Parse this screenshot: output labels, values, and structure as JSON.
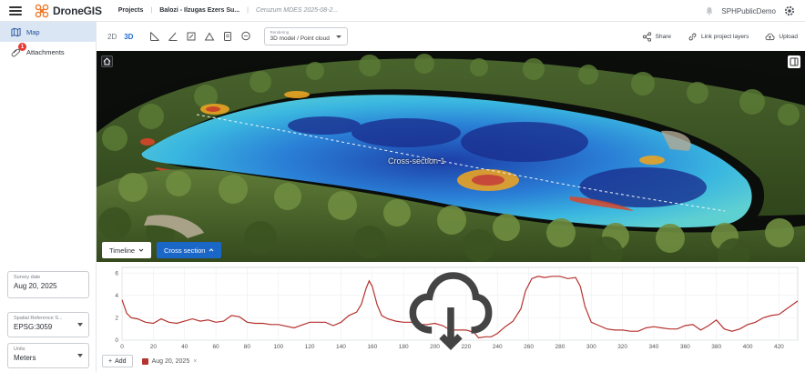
{
  "app": {
    "name": "DroneGIS",
    "user": "SPHPublicDemo"
  },
  "breadcrumbs": [
    "Projects",
    "Balozi - Ilzugas Ezers Su...",
    "Ceruzum MDES 2025-08-2..."
  ],
  "nav": {
    "map_label": "Map",
    "attachments_label": "Attachments",
    "attachments_count": "1"
  },
  "fields": {
    "survey_date": {
      "label": "Survey date",
      "value": "Aug 20, 2025"
    },
    "crs": {
      "label": "Spatial Reference S...",
      "value": "EPSG:3059"
    },
    "units": {
      "label": "Units",
      "value": "Meters"
    }
  },
  "toolbar": {
    "mode_2d": "2D",
    "mode_3d": "3D",
    "view_select": {
      "label": "Rendering",
      "value": "3D model / Point cloud"
    },
    "share_label": "Share",
    "link_label": "Link project layers",
    "upload_label": "Upload"
  },
  "viewport": {
    "cross_section_label": "Cross-section 1",
    "timeline_label": "Timeline",
    "cross_section_button": "Cross section"
  },
  "profile": {
    "add_label": "Add",
    "legend_label": "Aug 20, 2025",
    "colors": {
      "line": "#b5322e",
      "accent": "#1a67c8"
    }
  },
  "chart_data": {
    "type": "line",
    "x_ticks": [
      0,
      20,
      40,
      60,
      80,
      100,
      120,
      140,
      160,
      180,
      200,
      220,
      240,
      260,
      280,
      300,
      320,
      340,
      360,
      380,
      400,
      420
    ],
    "y_ticks": [
      0,
      2,
      4,
      6
    ],
    "xlim": [
      0,
      432
    ],
    "ylim": [
      0,
      6.5
    ],
    "grid": true,
    "series": [
      {
        "x": [
          0,
          3,
          6,
          10,
          15,
          20,
          25,
          30,
          35,
          40,
          45,
          50,
          55,
          60,
          65,
          70,
          75,
          80,
          85,
          90,
          95,
          100,
          110,
          120,
          130,
          135,
          140,
          145,
          150,
          153,
          156,
          158,
          160,
          163,
          166,
          170,
          175,
          180,
          185,
          190,
          195,
          200,
          205,
          210,
          215,
          220,
          225,
          228,
          232,
          236,
          240,
          245,
          250,
          255,
          258,
          262,
          266,
          270,
          275,
          280,
          285,
          290,
          293,
          296,
          300,
          305,
          310,
          315,
          320,
          325,
          330,
          335,
          340,
          345,
          350,
          355,
          360,
          365,
          370,
          375,
          380,
          385,
          390,
          395,
          400,
          405,
          410,
          415,
          420,
          425,
          430,
          432
        ],
        "y": [
          3.6,
          2.4,
          2.0,
          1.9,
          1.6,
          1.5,
          1.9,
          1.6,
          1.5,
          1.7,
          1.9,
          1.7,
          1.8,
          1.6,
          1.7,
          2.2,
          2.1,
          1.6,
          1.5,
          1.5,
          1.4,
          1.4,
          1.1,
          1.6,
          1.6,
          1.3,
          1.6,
          2.2,
          2.5,
          3.2,
          4.6,
          5.3,
          4.8,
          3.2,
          2.2,
          1.9,
          1.7,
          1.6,
          1.6,
          1.4,
          1.4,
          1.5,
          1.3,
          0.9,
          0.9,
          0.9,
          0.7,
          0.2,
          0.3,
          0.3,
          0.6,
          1.2,
          1.7,
          2.8,
          4.4,
          5.5,
          5.7,
          5.6,
          5.7,
          5.7,
          5.5,
          5.6,
          4.8,
          3.0,
          1.6,
          1.3,
          1.0,
          0.9,
          0.9,
          0.8,
          0.8,
          1.1,
          1.2,
          1.1,
          1.0,
          1.0,
          1.3,
          1.4,
          0.9,
          1.3,
          1.8,
          1.0,
          0.8,
          1.0,
          1.4,
          1.6,
          2.0,
          2.2,
          2.3,
          2.8,
          3.3,
          3.5
        ]
      }
    ]
  }
}
